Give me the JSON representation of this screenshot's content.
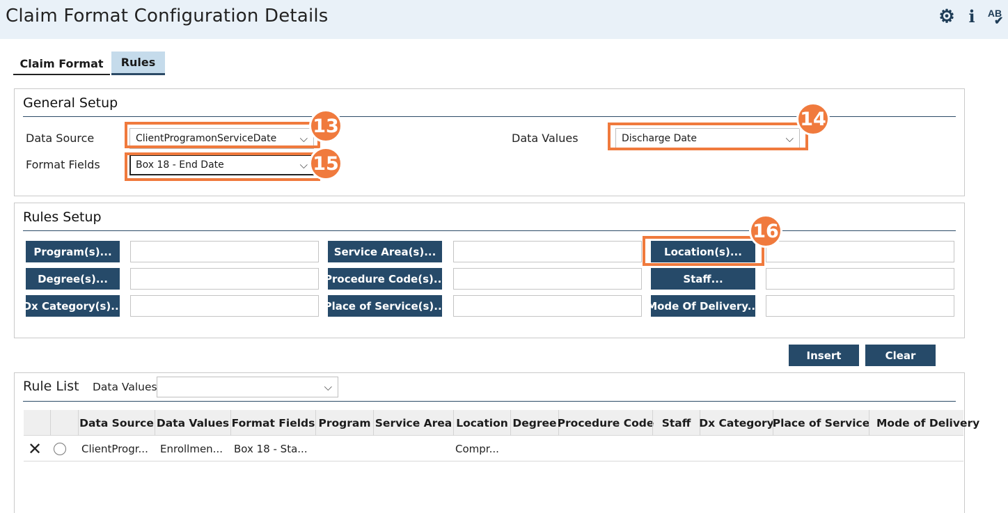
{
  "header": {
    "title": "Claim Format Configuration Details",
    "icons": [
      "gear-icon",
      "info-icon",
      "spellcheck-icon"
    ],
    "ab_text": "AB"
  },
  "tabs": [
    {
      "label": "Claim Format",
      "active": false
    },
    {
      "label": "Rules",
      "active": true
    }
  ],
  "general_setup": {
    "title": "General Setup",
    "data_source": {
      "label": "Data Source",
      "value": "ClientProgramonServiceDate"
    },
    "data_values": {
      "label": "Data Values",
      "value": "Discharge Date"
    },
    "format_fields": {
      "label": "Format Fields",
      "value": "Box 18 - End Date"
    }
  },
  "callouts": [
    "13",
    "14",
    "15",
    "16"
  ],
  "rules_setup": {
    "title": "Rules Setup",
    "buttons": [
      "Program(s)...",
      "Service Area(s)...",
      "Location(s)...",
      "Degree(s)...",
      "Procedure Code(s)...",
      "Staff...",
      "Dx Category(s)...",
      "Place of Service(s)...",
      "Mode Of Delivery..."
    ]
  },
  "actions": {
    "insert": "Insert",
    "clear": "Clear"
  },
  "rule_list": {
    "title": "Rule List",
    "filter_label": "Data Values",
    "filter_value": "",
    "columns": [
      "Data Source",
      "Data Values",
      "Format Fields",
      "Program",
      "Service Area",
      "Location",
      "Degree",
      "Procedure Code",
      "Staff",
      "Dx Category",
      "Place of Service",
      "Mode of Delivery"
    ],
    "rows": [
      {
        "data_source": "ClientProgr...",
        "data_values": "Enrollmen...",
        "format_fields": "Box 18 - Sta...",
        "program": "",
        "service_area": "",
        "location": "Compr...",
        "degree": "",
        "procedure_code": "",
        "staff": "",
        "dx_category": "",
        "place_of_service": "",
        "mode_of_delivery": ""
      }
    ]
  },
  "colors": {
    "header_bg": "#e9f1f8",
    "button_bg": "#264a69",
    "callout": "#f07a3d",
    "tab_active_bg": "#c5dbeb"
  }
}
